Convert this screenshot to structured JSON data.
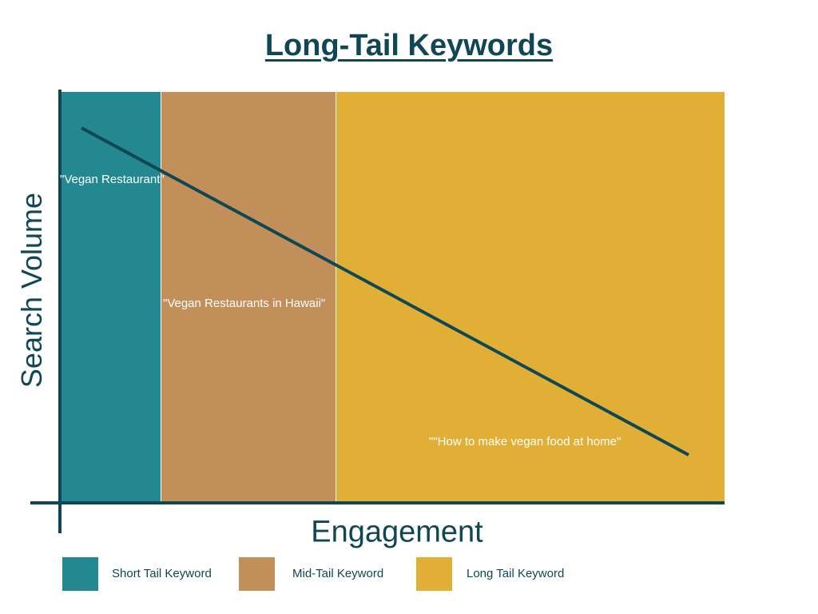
{
  "title": "Long-Tail Keywords",
  "axes": {
    "y_label": "Search Volume",
    "x_label": "Engagement"
  },
  "colors": {
    "short": "#238890",
    "mid": "#C28F5B",
    "long": "#E2AF36",
    "ink": "#0F4754"
  },
  "annotations": {
    "short": "\"Vegan Restaurant\"",
    "mid": "\"Vegan Restaurants in Hawaii\"",
    "long": "\"\"How to make vegan food at home\""
  },
  "legend": [
    {
      "label": "Short Tail Keyword",
      "color": "#238890"
    },
    {
      "label": "Mid-Tail Keyword",
      "color": "#C28F5B"
    },
    {
      "label": "Long Tail Keyword",
      "color": "#E2AF36"
    }
  ]
}
